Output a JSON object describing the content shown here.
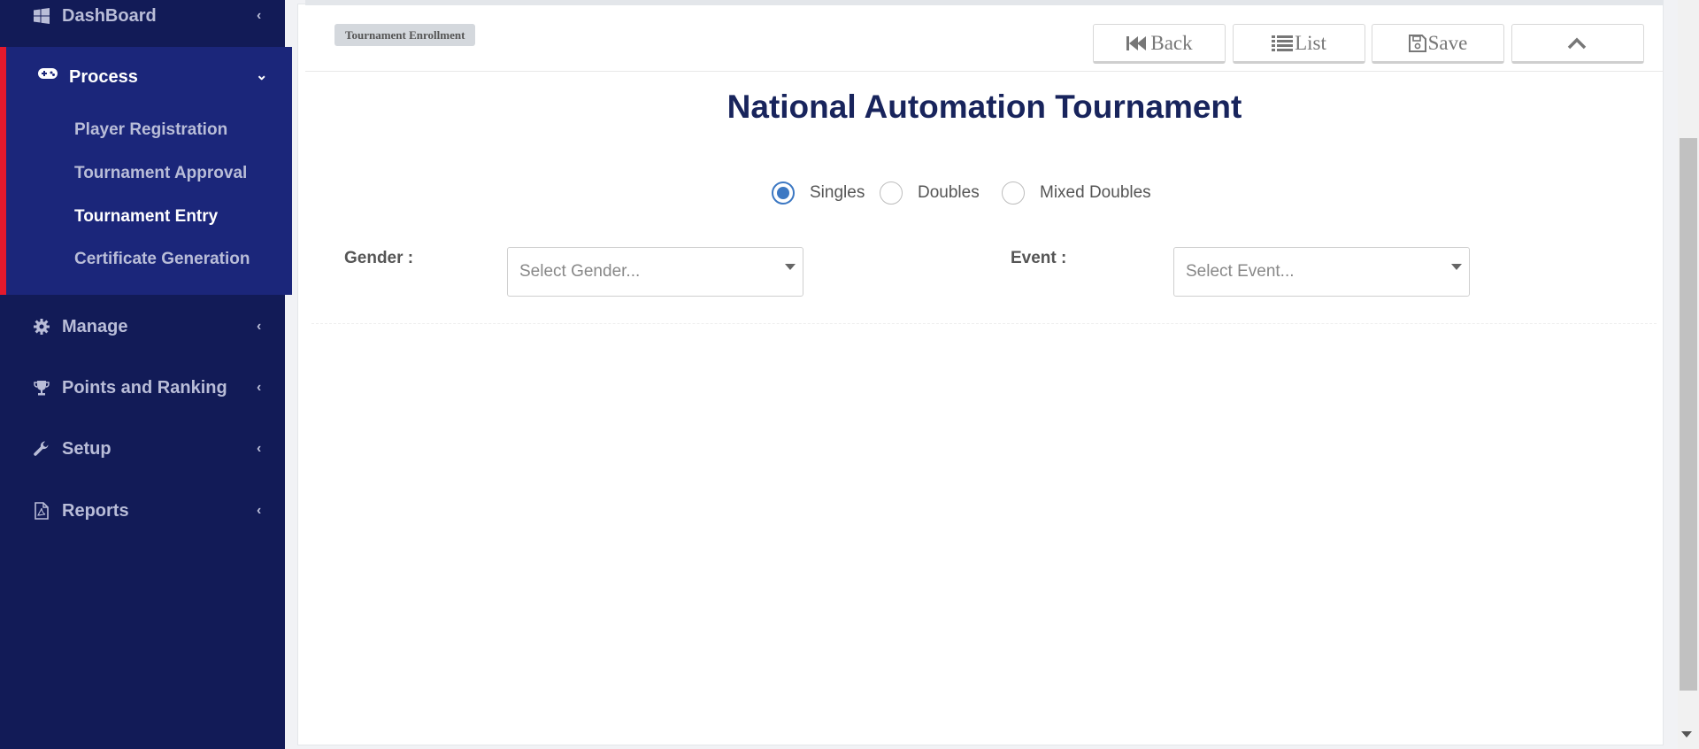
{
  "sidebar": {
    "dashboard": "DashBoard",
    "process": {
      "label": "Process",
      "items": [
        "Player Registration",
        "Tournament Approval",
        "Tournament Entry",
        "Certificate Generation"
      ]
    },
    "manage": "Manage",
    "points": "Points and Ranking",
    "setup": "Setup",
    "reports": "Reports"
  },
  "breadcrumb": "Tournament Enrollment",
  "toolbar": {
    "back": "Back",
    "list": "List",
    "save": "Save"
  },
  "page_title": "National Automation Tournament",
  "match_type": {
    "options": [
      "Singles",
      "Doubles",
      "Mixed Doubles"
    ],
    "selected": "Singles"
  },
  "form": {
    "gender_label": "Gender :",
    "gender_placeholder": "Select Gender...",
    "event_label": "Event :",
    "event_placeholder": "Select Event..."
  },
  "colors": {
    "sidebar_bg": "#121b57",
    "sidebar_active_bg": "#1b267a",
    "active_marker": "#e3192d",
    "title": "#18245c",
    "radio_accent": "#3c78c3"
  }
}
